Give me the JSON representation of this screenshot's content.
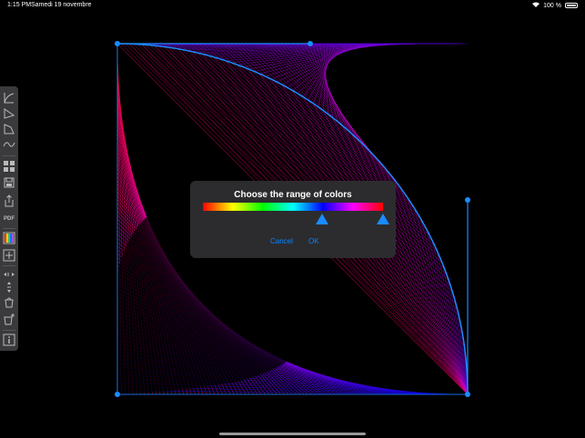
{
  "status_bar": {
    "time": "1:15 PM",
    "date": "Samedi 19 novembre",
    "battery": "100 %"
  },
  "toolbar": {
    "pdf_label": "PDF",
    "icons": [
      "curve-tool-icon",
      "triangle-tool-icon",
      "quadrilateral-tool-icon",
      "wave-tool-icon",
      "grid-icon",
      "save-icon",
      "share-icon",
      "pdf-icon",
      "color-palette-icon",
      "add-icon",
      "horizontal-arrows-icon",
      "vertical-arrows-icon",
      "bucket-icon",
      "bucket-plus-icon",
      "info-icon"
    ]
  },
  "dialog": {
    "title": "Choose the range of colors",
    "cancel_label": "Cancel",
    "ok_label": "OK",
    "range_start": 0.66,
    "range_end": 1.0
  },
  "colors": {
    "control_blue": "#1a8cff",
    "dialog_bg": "#2c2c2e",
    "toolbar_bg": "#3a3a3c",
    "link_blue": "#0a84ff"
  }
}
